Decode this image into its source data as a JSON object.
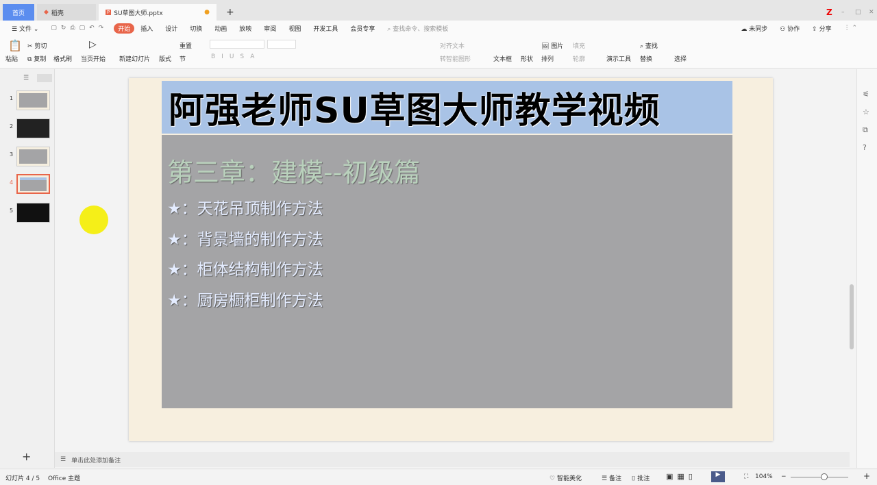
{
  "tabs": [
    {
      "label": "首页"
    },
    {
      "label": "稻壳"
    },
    {
      "label": "SU草图大师.pptx"
    }
  ],
  "window": {
    "new_tab": "+",
    "minimize": "–",
    "maximize": "□",
    "close": "✕"
  },
  "menu": {
    "file": "文件",
    "items": [
      "开始",
      "插入",
      "设计",
      "切换",
      "动画",
      "放映",
      "审阅",
      "视图",
      "开发工具",
      "会员专享"
    ],
    "search_placeholder": "查找命令、搜索模板",
    "sync": "未同步",
    "collab": "协作",
    "share": "分享"
  },
  "toolbar": {
    "paste": "粘贴",
    "cut": "剪切",
    "copy": "复制",
    "format_painter": "格式刷",
    "play_current": "当页开始",
    "new_slide": "新建幻灯片",
    "layout": "版式",
    "reset": "重置",
    "section": "节",
    "align_text": "对齐文本",
    "smartart": "转智能图形",
    "textbox": "文本框",
    "shape": "形状",
    "picture": "图片",
    "fill": "填充",
    "arrange": "排列",
    "outline": "轮廓",
    "present_tools": "演示工具",
    "find": "查找",
    "replace": "替换",
    "select": "选择"
  },
  "thumbnails": [
    {
      "num": "1"
    },
    {
      "num": "2"
    },
    {
      "num": "3"
    },
    {
      "num": "4",
      "selected": true
    },
    {
      "num": "5"
    }
  ],
  "slide": {
    "title": "阿强老师SU草图大师教学视频",
    "chapter": "第三章：建模--初级篇",
    "bullets": [
      "★：天花吊顶制作方法",
      "★：背景墙的制作方法",
      "★：柜体结构制作方法",
      "★：厨房橱柜制作方法"
    ]
  },
  "notes": {
    "placeholder": "单击此处添加备注",
    "add": "+"
  },
  "status": {
    "slide_counter": "幻灯片 4 / 5",
    "theme": "Office 主题",
    "beautify": "智能美化",
    "notes": "备注",
    "comment": "批注",
    "zoom": "104%",
    "zoom_level": 104
  },
  "colors": {
    "accent": "#e8654a",
    "title_bg": "#a9c3e6",
    "content_bg": "#a4a4a6",
    "slide_bg": "#f7efdf",
    "home_tab": "#5b8def"
  }
}
